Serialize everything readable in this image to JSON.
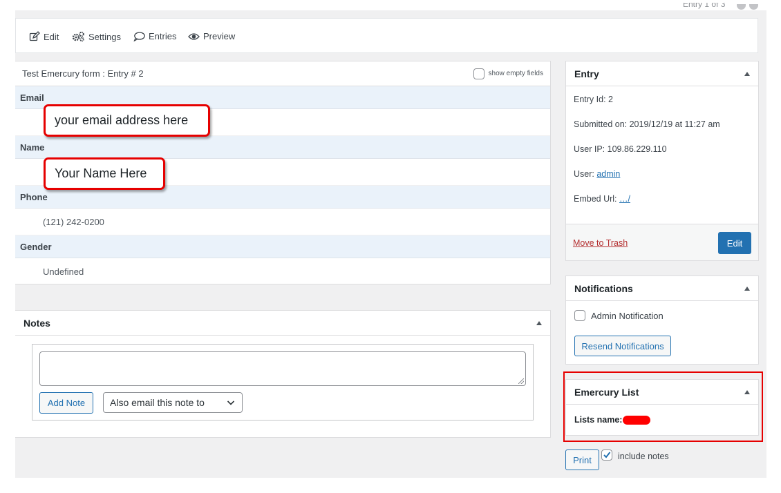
{
  "toolbar": {
    "cutoff_label": "Entry 1 of 3",
    "edit": "Edit",
    "settings": "Settings",
    "entries": "Entries",
    "preview": "Preview"
  },
  "entry": {
    "title": "Test Emercury form : Entry # 2",
    "show_empty_fields": "show empty fields",
    "fields": [
      {
        "label": "Email",
        "value": "your email address here"
      },
      {
        "label": "Name",
        "value": "Your Name Here"
      },
      {
        "label": "Phone",
        "value": "(121) 242-0200"
      },
      {
        "label": "Gender",
        "value": "Undefined"
      }
    ]
  },
  "notes": {
    "title": "Notes",
    "textarea_value": "",
    "add_note": "Add Note",
    "email_select": "Also email this note to"
  },
  "entry_box": {
    "title": "Entry",
    "entry_id": "Entry Id: 2",
    "submitted": "Submitted on: 2019/12/19 at 11:27 am",
    "user_ip": "User IP: 109.86.229.110",
    "user_label": "User: ",
    "user_link": "admin",
    "embed_label": "Embed Url: ",
    "embed_link": "…/",
    "trash": "Move to Trash",
    "edit": "Edit"
  },
  "notifications": {
    "title": "Notifications",
    "admin": "Admin Notification",
    "resend": "Resend Notifications"
  },
  "emercury": {
    "title": "Emercury List",
    "lists_name": "Lists name:"
  },
  "print": {
    "button": "Print",
    "include_notes": "include notes",
    "include_notes_checked": true
  },
  "colors": {
    "accent": "#2271b1",
    "highlight": "#e60000",
    "field_label_bg": "#eaf2fa"
  }
}
